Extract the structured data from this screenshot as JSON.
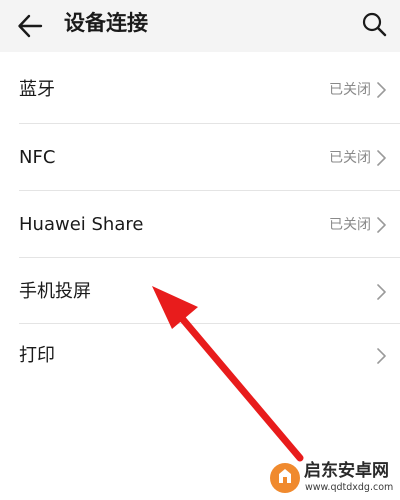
{
  "header": {
    "title": "设备连接",
    "back_icon": "arrow-left-icon",
    "search_icon": "search-icon"
  },
  "list": {
    "items": [
      {
        "label": "蓝牙",
        "status": "已关闭"
      },
      {
        "label": "NFC",
        "status": "已关闭"
      },
      {
        "label": "Huawei Share",
        "status": "已关闭"
      },
      {
        "label": "手机投屏",
        "status": ""
      },
      {
        "label": "打印",
        "status": ""
      }
    ]
  },
  "annotation": {
    "color": "#e81c1c",
    "icon": "red-arrow-pointing-to-screen-projection"
  },
  "watermark": {
    "brand": "启东安卓网",
    "url": "www.qdtdxdg.com"
  },
  "colors": {
    "background": "#f4f4f4",
    "list_background": "#ffffff",
    "text": "#1a1a1a",
    "muted": "#8a8a8a",
    "divider": "#e4e4e4",
    "watermark_logo": "#f08a2e"
  }
}
